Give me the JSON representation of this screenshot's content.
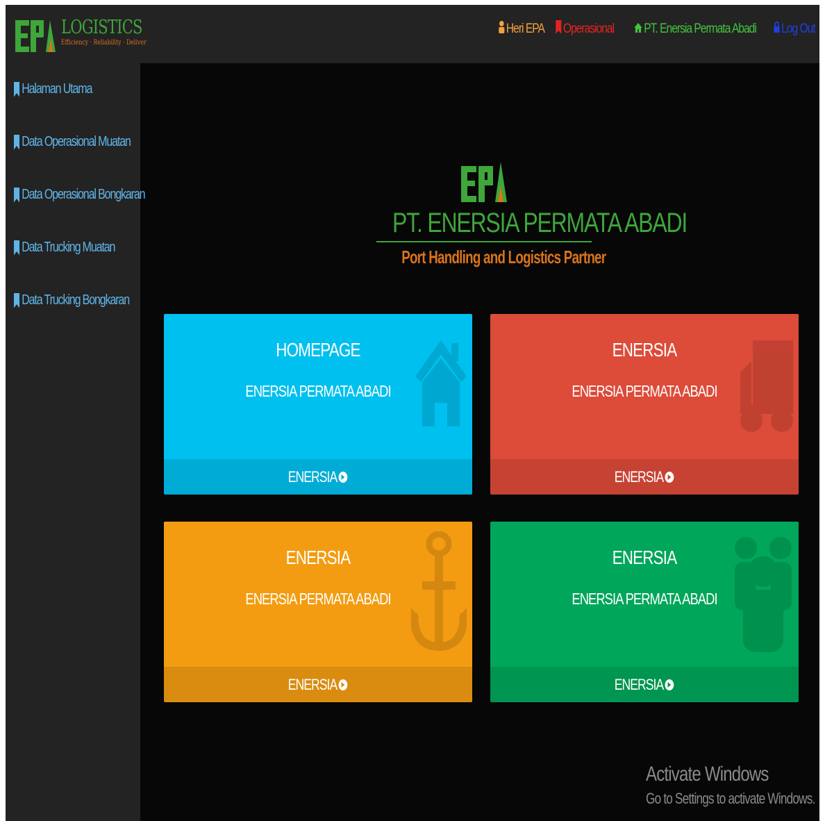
{
  "brand": {
    "logo_letters": "EPA",
    "title": "LOGISTICS",
    "tagline": "Efficiency · Reliability · Deliver"
  },
  "navbar": {
    "user": {
      "label": "Heri EPA",
      "icon": "user-icon"
    },
    "operational": {
      "label": "Operasional",
      "icon": "bookmark-icon"
    },
    "company": {
      "label": "PT. Enersia Permata Abadi",
      "icon": "home-icon"
    },
    "logout": {
      "label": "Log Out",
      "icon": "lock-icon"
    }
  },
  "sidebar": {
    "items": [
      {
        "label": "Halaman Utama",
        "icon": "bookmark-icon"
      },
      {
        "label": "Data Operasional Muatan",
        "icon": "bookmark-icon"
      },
      {
        "label": "Data Operasional Bongkaran",
        "icon": "bookmark-icon"
      },
      {
        "label": "Data Trucking Muatan",
        "icon": "bookmark-icon"
      },
      {
        "label": "Data Trucking Bongkaran",
        "icon": "bookmark-icon"
      }
    ]
  },
  "main": {
    "company_name": "PT. ENERSIA PERMATA ABADI",
    "tagline": "Port Handling and Logistics Partner",
    "cards": [
      {
        "title": "HOMEPAGE",
        "subtitle": "ENERSIA PERMATA ABADI",
        "footer": "ENERSIA",
        "icon": "home-icon",
        "color": "#00c0ef"
      },
      {
        "title": "ENERSIA",
        "subtitle": "ENERSIA PERMATA ABADI",
        "footer": "ENERSIA",
        "icon": "truck-icon",
        "color": "#dd4b39"
      },
      {
        "title": "ENERSIA",
        "subtitle": "ENERSIA PERMATA ABADI",
        "footer": "ENERSIA",
        "icon": "anchor-icon",
        "color": "#f39c12"
      },
      {
        "title": "ENERSIA",
        "subtitle": "ENERSIA PERMATA ABADI",
        "footer": "ENERSIA",
        "icon": "users-icon",
        "color": "#00a65a"
      }
    ]
  },
  "watermark": {
    "title": "Activate Windows",
    "subtitle": "Go to Settings to activate Windows."
  },
  "colors": {
    "brand_green": "#3ea63a",
    "brand_orange": "#d9731c",
    "sidebar_link": "#5fb4e6",
    "navbar_bg": "#232323",
    "content_bg": "#070707"
  }
}
